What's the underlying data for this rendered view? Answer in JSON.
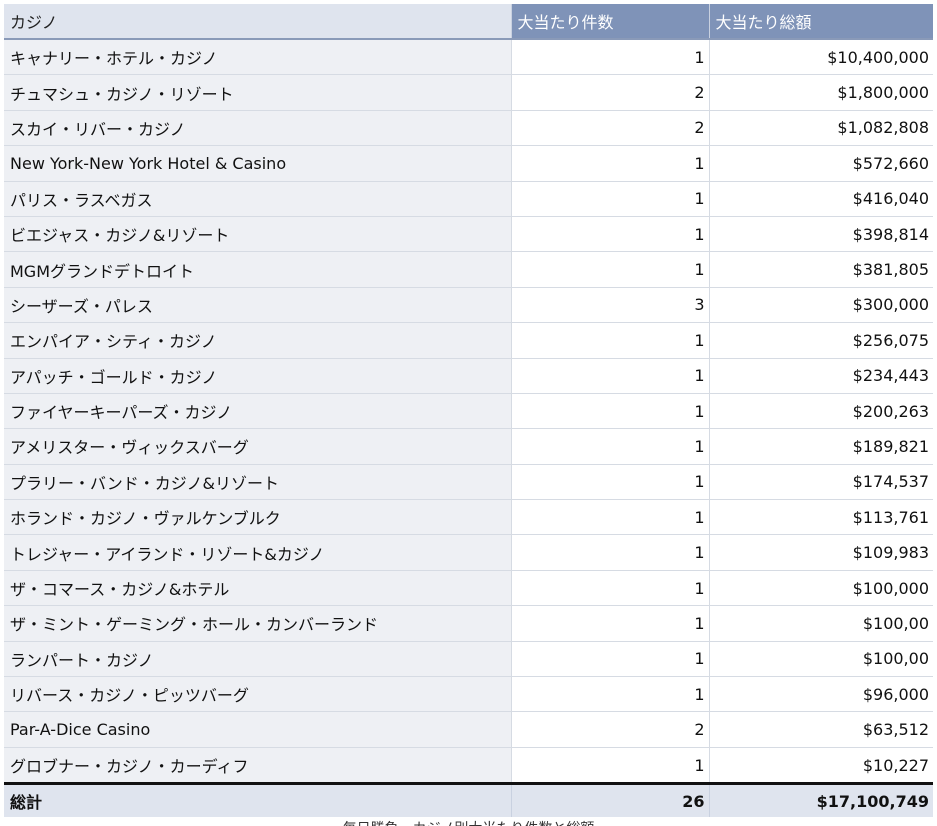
{
  "table": {
    "headers": {
      "casino": "カジノ",
      "count": "大当たり件数",
      "total": "大当たり総額"
    },
    "rows": [
      {
        "casino": "キャナリー・ホテル・カジノ",
        "count": "1",
        "total": "$10,400,000"
      },
      {
        "casino": "チュマシュ・カジノ・リゾート",
        "count": "2",
        "total": "$1,800,000"
      },
      {
        "casino": "スカイ・リバー・カジノ",
        "count": "2",
        "total": "$1,082,808"
      },
      {
        "casino": "New York-New York Hotel & Casino",
        "count": "1",
        "total": "$572,660"
      },
      {
        "casino": "パリス・ラスベガス",
        "count": "1",
        "total": "$416,040"
      },
      {
        "casino": "ビエジャス・カジノ&リゾート",
        "count": "1",
        "total": "$398,814"
      },
      {
        "casino": "MGMグランドデトロイト",
        "count": "1",
        "total": "$381,805"
      },
      {
        "casino": "シーザーズ・パレス",
        "count": "3",
        "total": "$300,000"
      },
      {
        "casino": "エンパイア・シティ・カジノ",
        "count": "1",
        "total": "$256,075"
      },
      {
        "casino": "アパッチ・ゴールド・カジノ",
        "count": "1",
        "total": "$234,443"
      },
      {
        "casino": "ファイヤーキーパーズ・カジノ",
        "count": "1",
        "total": "$200,263"
      },
      {
        "casino": "アメリスター・ヴィックスバーグ",
        "count": "1",
        "total": "$189,821"
      },
      {
        "casino": "プラリー・バンド・カジノ&リゾート",
        "count": "1",
        "total": "$174,537"
      },
      {
        "casino": "ホランド・カジノ・ヴァルケンブルク",
        "count": "1",
        "total": "$113,761"
      },
      {
        "casino": "トレジャー・アイランド・リゾート&カジノ",
        "count": "1",
        "total": "$109,983"
      },
      {
        "casino": "ザ・コマース・カジノ&ホテル",
        "count": "1",
        "total": "$100,000"
      },
      {
        "casino": "ザ・ミント・ゲーミング・ホール・カンバーランド",
        "count": "1",
        "total": "$100,00"
      },
      {
        "casino": "ランパート・カジノ",
        "count": "1",
        "total": "$100,00"
      },
      {
        "casino": "リバース・カジノ・ピッツバーグ",
        "count": "1",
        "total": "$96,000"
      },
      {
        "casino": "Par-A-Dice Casino",
        "count": "2",
        "total": "$63,512"
      },
      {
        "casino": "グロブナー・カジノ・カーディフ",
        "count": "1",
        "total": "$10,227"
      }
    ],
    "footer": {
      "label": "総計",
      "count": "26",
      "total": "$17,100,749"
    }
  },
  "caption": "毎日勝負、カジノ別大当たり件数と総額"
}
